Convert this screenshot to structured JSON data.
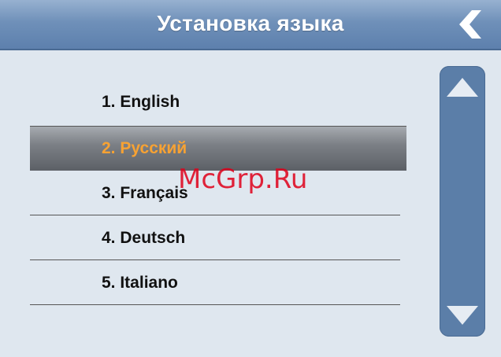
{
  "header": {
    "title": "Установка языка",
    "back_icon": "chevron-left-icon"
  },
  "languages": [
    {
      "label": "1. English"
    },
    {
      "label": "2. Русский",
      "selected": true
    },
    {
      "label": "3. Français"
    },
    {
      "label": "4. Deutsch"
    },
    {
      "label": "5. Italiano"
    }
  ],
  "scrollbar": {
    "up_icon": "triangle-up-icon",
    "down_icon": "triangle-down-icon"
  },
  "watermark": "McGrp.Ru",
  "colors": {
    "header": "#6f90b9",
    "selected_text": "#f7a233",
    "scrollbar": "#5b7ea8",
    "watermark": "#e0001a"
  }
}
